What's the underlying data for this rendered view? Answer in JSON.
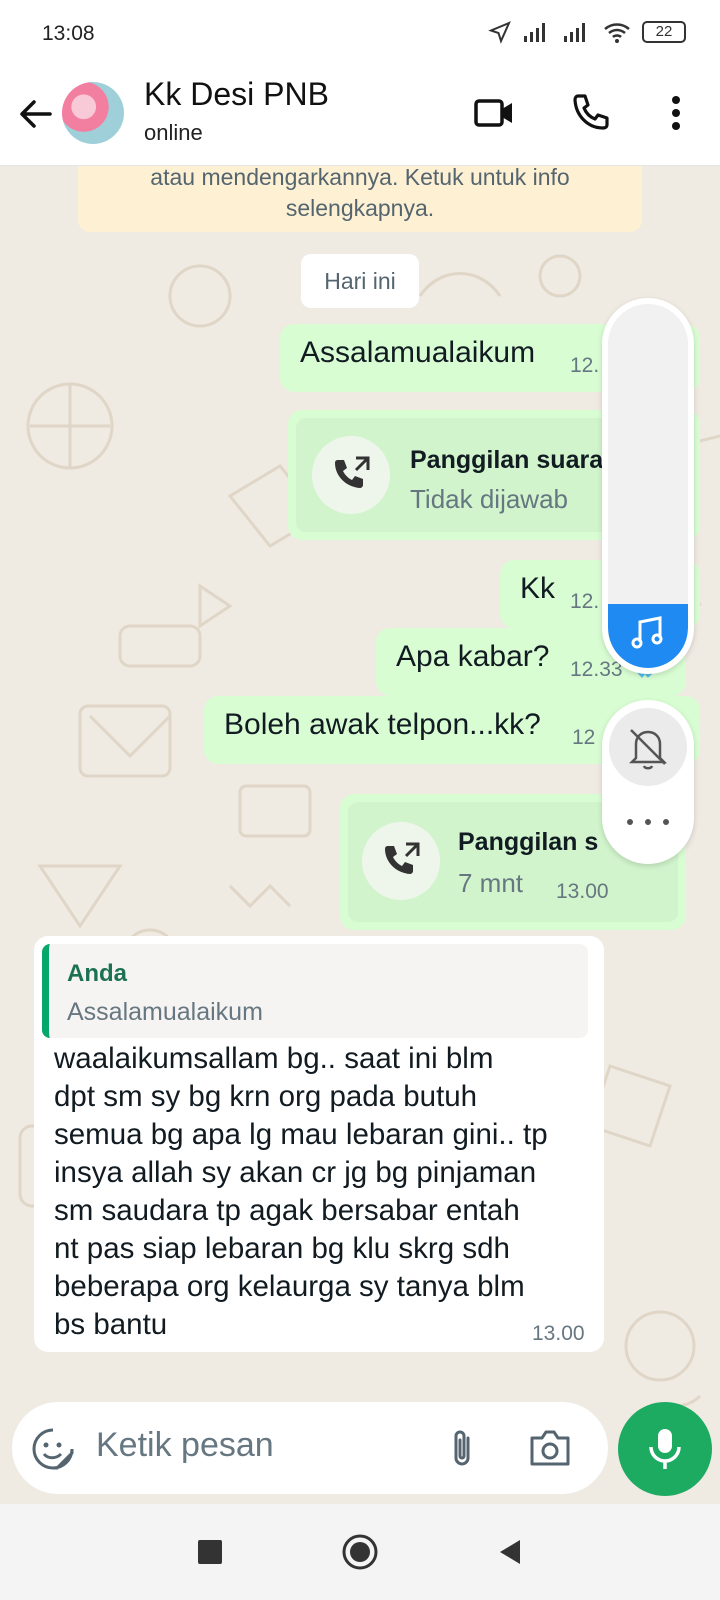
{
  "status_bar": {
    "time": "13:08",
    "battery": "22"
  },
  "header": {
    "contact_name": "Kk Desi PNB",
    "contact_status": "online"
  },
  "notice": {
    "line1": "atau mendengarkannya. Ketuk untuk info",
    "line2": "selengkapnya."
  },
  "day_chip": "Hari ini",
  "messages": [
    {
      "type": "text",
      "direction": "out",
      "text": "Assalamualaikum",
      "time": "12."
    },
    {
      "type": "call",
      "direction": "out",
      "title": "Panggilan suara",
      "subtitle": "Tidak dijawab"
    },
    {
      "type": "text",
      "direction": "out",
      "text": "Kk",
      "time": "12."
    },
    {
      "type": "text",
      "direction": "out",
      "text": "Apa kabar?",
      "time": "12.33"
    },
    {
      "type": "text",
      "direction": "out",
      "text": "Boleh awak telpon...kk?",
      "time": "12"
    },
    {
      "type": "call",
      "direction": "out",
      "title": "Panggilan s",
      "subtitle": "7 mnt",
      "time": "13.00"
    }
  ],
  "reply": {
    "quote_author": "Anda",
    "quote_text": "Assalamualaikum",
    "lines": [
      "waalaikumsallam bg.. saat ini blm",
      "dpt sm sy bg krn org pada butuh",
      "semua bg apa lg mau lebaran gini.. tp",
      "insya allah sy akan cr jg bg pinjaman",
      "sm saudara tp agak bersabar entah",
      "nt pas siap lebaran bg klu skrg sdh",
      "beberapa org kelaurga sy tanya blm",
      "bs bantu"
    ],
    "time": "13.00"
  },
  "composer": {
    "placeholder": "Ketik pesan"
  },
  "colors": {
    "outgoing": "#d9fdd3",
    "incoming": "#ffffff",
    "accent": "#1daa61",
    "read_ticks": "#53bdeb"
  },
  "icons": [
    "back-arrow-icon",
    "video-call-icon",
    "voice-call-icon",
    "more-vert-icon",
    "outgoing-call-icon",
    "sticker-icon",
    "attach-icon",
    "camera-icon",
    "mic-icon",
    "music-icon",
    "mute-bell-icon",
    "more-horiz-icon"
  ]
}
